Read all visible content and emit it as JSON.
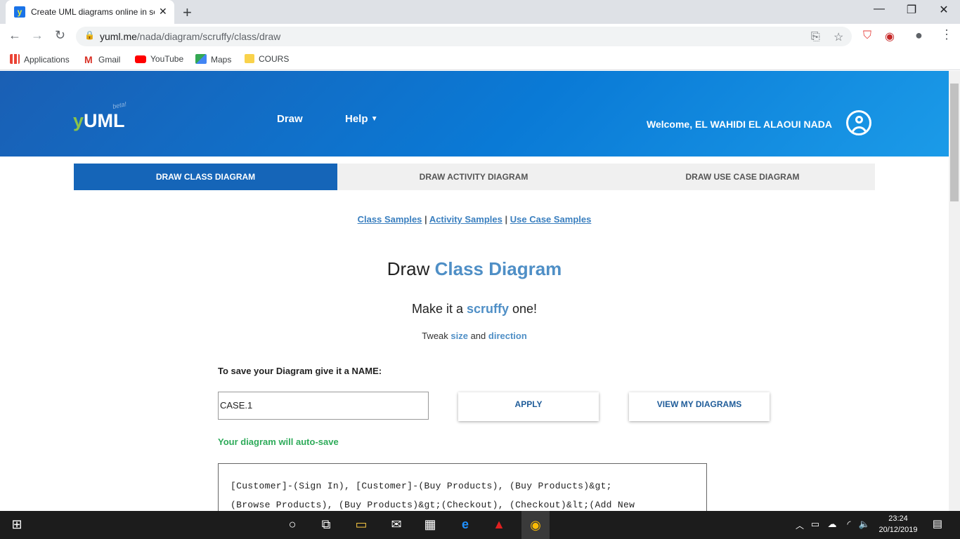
{
  "browser": {
    "tab_title": "Create UML diagrams online in se",
    "tab_favicon": "y",
    "url_host": "yuml.me",
    "url_path": "/nada/diagram/scruffy/class/draw",
    "bookmarks": [
      {
        "label": "Applications",
        "icon": "apps-grid-icon",
        "color": "#ea4335"
      },
      {
        "label": "Gmail",
        "icon": "gmail-icon",
        "color": "#d93025"
      },
      {
        "label": "YouTube",
        "icon": "youtube-icon",
        "color": "#ff0000"
      },
      {
        "label": "Maps",
        "icon": "maps-icon",
        "color": "#34a853"
      },
      {
        "label": "COURS",
        "icon": "folder-icon",
        "color": "#f9d24b"
      }
    ]
  },
  "site": {
    "logo_y": "y",
    "logo_rest": "UML",
    "logo_beta": "beta!",
    "nav": {
      "draw": "Draw",
      "help": "Help"
    },
    "welcome": "Welcome, EL WAHIDI EL ALAOUI NADA",
    "tabs": [
      {
        "label": "DRAW CLASS DIAGRAM",
        "active": true
      },
      {
        "label": "DRAW ACTIVITY DIAGRAM",
        "active": false
      },
      {
        "label": "DRAW USE CASE DIAGRAM",
        "active": false
      }
    ],
    "samples": [
      "Class Samples",
      "Activity Samples",
      "Use Case Samples"
    ],
    "heading_plain": "Draw ",
    "heading_accent": "Class Diagram",
    "sub1_a": "Make it a ",
    "sub1_accent": "scruffy",
    "sub1_b": " one!",
    "sub2_a": "Tweak ",
    "sub2_size": "size",
    "sub2_and": " and ",
    "sub2_direction": "direction",
    "name_label": "To save your Diagram give it a NAME:",
    "name_value": "CASE.1",
    "apply_label": "APPLY",
    "view_label": "VIEW MY DIAGRAMS",
    "autosave": "Your diagram will auto-save",
    "code": "[Customer]-(Sign In), [Customer]-(Buy Products), (Buy Products)&gt;\n(Browse Products), (Buy Products)&gt;(Checkout), (Checkout)&lt;(Add New"
  },
  "taskbar": {
    "time": "23:24",
    "date": "20/12/2019"
  },
  "colors": {
    "accent": "#4f8fc6",
    "active_tab": "#1565b8",
    "inactive_tab": "#f0f0f0",
    "autosave_green": "#2eab5a"
  }
}
